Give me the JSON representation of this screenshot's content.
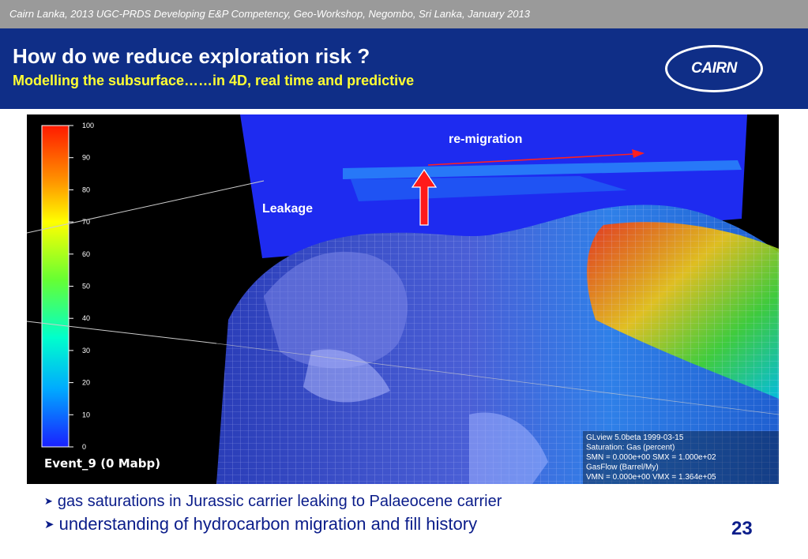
{
  "top_bar": {
    "citation": "Cairn Lanka, 2013 UGC-PRDS Developing E&P Competency, Geo-Workshop, Negombo, Sri Lanka, January 2013"
  },
  "header": {
    "title": "How do we reduce exploration risk ?",
    "subtitle": "Modelling the subsurface……in 4D, real time and predictive",
    "logo_text": "CAIRN"
  },
  "figure": {
    "labels": {
      "remigration": "re-migration",
      "leakage": "Leakage",
      "event": "Event_9 (0 Mabp)"
    },
    "legend_ticks": [
      "100",
      "90",
      "80",
      "70",
      "60",
      "50",
      "40",
      "30",
      "20",
      "10",
      "0"
    ],
    "info_box": [
      "GLview 5.0beta  1999-03-15",
      "Saturation: Gas (percent)",
      "SMN = 0.000e+00  SMX = 1.000e+02",
      "GasFlow (Barrel/My)",
      "VMN = 0.000e+00  VMX = 1.364e+05"
    ]
  },
  "bullets": [
    {
      "icon": "arrowhead-bullet-icon",
      "text": "gas saturations in Jurassic carrier leaking to Palaeocene carrier"
    },
    {
      "icon": "arrowhead-bullet-icon",
      "text": "understanding of hydrocarbon migration and fill history"
    }
  ],
  "page_number": "23",
  "colors": {
    "header_bg": "#0f2e87",
    "subtitle": "#ffff33",
    "bullet_text": "#0b1d8a",
    "top_bar": "#9a9a9a"
  }
}
